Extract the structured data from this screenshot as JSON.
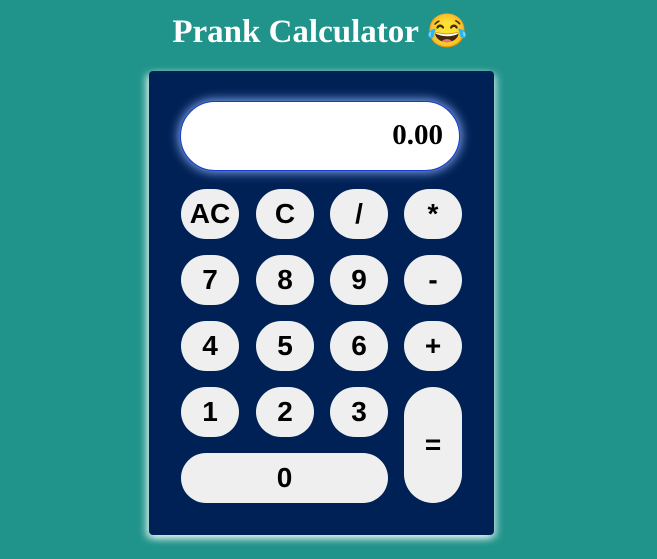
{
  "page": {
    "title": "Prank Calculator",
    "title_emoji": "😂"
  },
  "colors": {
    "background": "#20948b",
    "calculator_body": "#002155",
    "button": "#efefef",
    "display_border": "#1a3bcc"
  },
  "display": {
    "value": "0.00"
  },
  "buttons": {
    "ac": "AC",
    "c": "C",
    "divide": "/",
    "multiply": "*",
    "seven": "7",
    "eight": "8",
    "nine": "9",
    "minus": "-",
    "four": "4",
    "five": "5",
    "six": "6",
    "plus": "+",
    "one": "1",
    "two": "2",
    "three": "3",
    "equals": "=",
    "zero": "0"
  }
}
